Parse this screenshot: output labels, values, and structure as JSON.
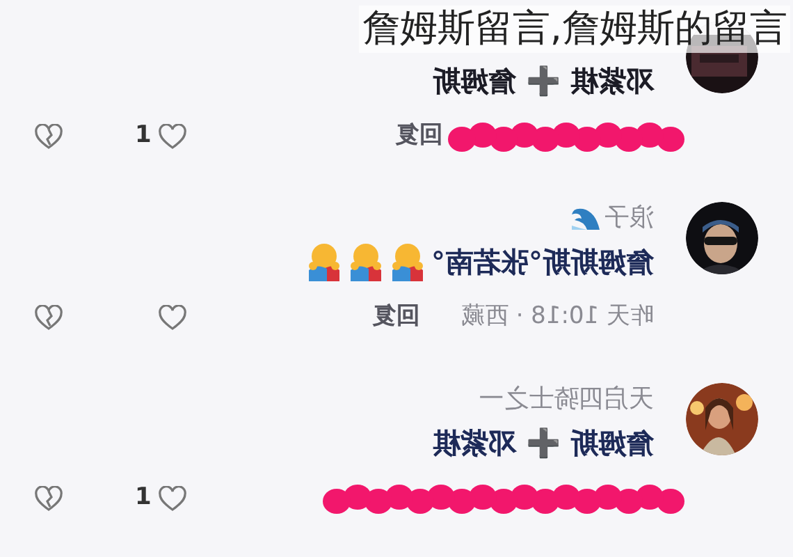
{
  "caption": "詹姆斯留言,詹姆斯的留言",
  "comments": [
    {
      "content": "邓紫棋 ➕ 詹姆斯",
      "footer": {
        "redacted": true,
        "reply": "回复"
      },
      "like_count": "1"
    },
    {
      "username": "浪子",
      "username_icon": {
        "kind": "wave"
      },
      "content": "詹姆斯斯°张若南°",
      "emojis": [
        {
          "kind": "hug"
        },
        {
          "kind": "hug"
        },
        {
          "kind": "hug"
        }
      ],
      "footer": {
        "redacted": false,
        "meta": "昨天 10:18 · 西藏",
        "reply": "回复"
      }
    },
    {
      "username": "天启四骑士之一",
      "content": "詹姆斯 ➕ 邓紫棋",
      "footer": {
        "redacted": true
      },
      "like_count": "1"
    }
  ]
}
